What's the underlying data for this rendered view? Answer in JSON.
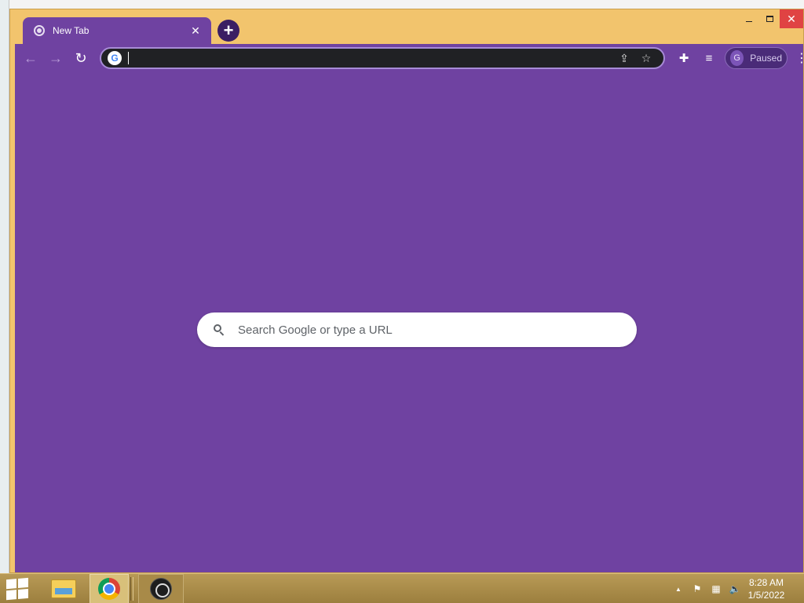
{
  "browser": {
    "tab": {
      "title": "New Tab",
      "close_glyph": "✕"
    },
    "new_tab_glyph": "+",
    "window_controls": {
      "close_glyph": "✕"
    },
    "toolbar": {
      "back_glyph": "←",
      "forward_glyph": "→",
      "reload_glyph": "↻",
      "omnibox_g": "G",
      "share_glyph": "⇪",
      "star_glyph": "☆",
      "extensions_glyph": "✚",
      "media_glyph": "≡",
      "profile": {
        "initial": "G",
        "label": "Paused"
      },
      "menu_glyph": "⋮"
    },
    "ntp": {
      "search_placeholder": "Search Google or type a URL"
    }
  },
  "taskbar": {
    "tray": {
      "up_glyph": "▲",
      "flag_glyph": "⚑",
      "network_glyph": "▦",
      "volume_glyph": "🔈"
    },
    "clock": {
      "time": "8:28 AM",
      "date": "1/5/2022"
    }
  },
  "colors": {
    "frame": "#f2c46d",
    "theme_purple": "#6f42a1",
    "omnibox_bg": "#202124",
    "close_red": "#e04343",
    "taskbar": "#b89a56"
  },
  "icons": [
    "chrome-favicon-icon",
    "plus-icon",
    "back-arrow-icon",
    "forward-arrow-icon",
    "reload-icon",
    "google-g-icon",
    "share-icon",
    "star-icon",
    "extensions-puzzle-icon",
    "media-queue-icon",
    "kebab-menu-icon",
    "search-icon",
    "windows-start-icon",
    "file-explorer-icon",
    "chrome-icon",
    "obs-icon"
  ]
}
